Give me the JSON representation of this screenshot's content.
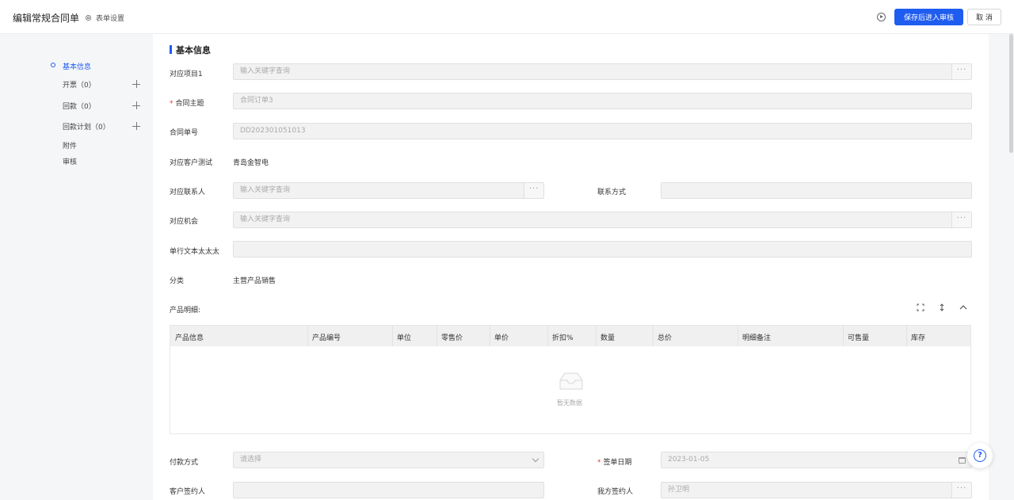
{
  "header": {
    "title": "编辑常规合同单",
    "form_settings": "表单设置",
    "save_submit": "保存后进入审核",
    "cancel": "取 消"
  },
  "nav": {
    "items": [
      {
        "label": "基本信息",
        "active": true
      },
      {
        "label": "开票（0）"
      },
      {
        "label": "回款（0）"
      },
      {
        "label": "回款计划（0）"
      },
      {
        "label": "附件"
      },
      {
        "label": "审核"
      }
    ]
  },
  "form": {
    "section_title": "基本信息",
    "project": {
      "label": "对应项目1",
      "placeholder": "输入关键字查询"
    },
    "subject": {
      "label": "合同主题",
      "value": "合同订单3"
    },
    "contract_no": {
      "label": "合同单号",
      "value": "DD202301051013"
    },
    "customer": {
      "label": "对应客户测试",
      "value": "青岛金智电"
    },
    "contact": {
      "label": "对应联系人",
      "placeholder": "输入关键字查询"
    },
    "contact_method": {
      "label": "联系方式",
      "value": ""
    },
    "opportunity": {
      "label": "对应机会",
      "placeholder": "输入关键字查询"
    },
    "single_line": {
      "label": "单行文本太太太",
      "value": ""
    },
    "category": {
      "label": "分类",
      "value": "主营产品销售"
    },
    "product_detail_label": "产品明细:",
    "payment": {
      "label": "付款方式",
      "placeholder": "请选择"
    },
    "sign_date": {
      "label": "签单日期",
      "value": "2023-01-05"
    },
    "customer_signer": {
      "label": "客户签约人",
      "value": ""
    },
    "our_signer": {
      "label": "我方签约人",
      "value": "孙卫明"
    }
  },
  "table": {
    "columns": [
      "产品信息",
      "产品编号",
      "单位",
      "零售价",
      "单价",
      "折扣%",
      "数量",
      "总价",
      "明细备注",
      "可售量",
      "库存"
    ],
    "empty_text": "暂无数据"
  },
  "colors": {
    "primary": "#1f5cf0",
    "required": "#e33333"
  }
}
